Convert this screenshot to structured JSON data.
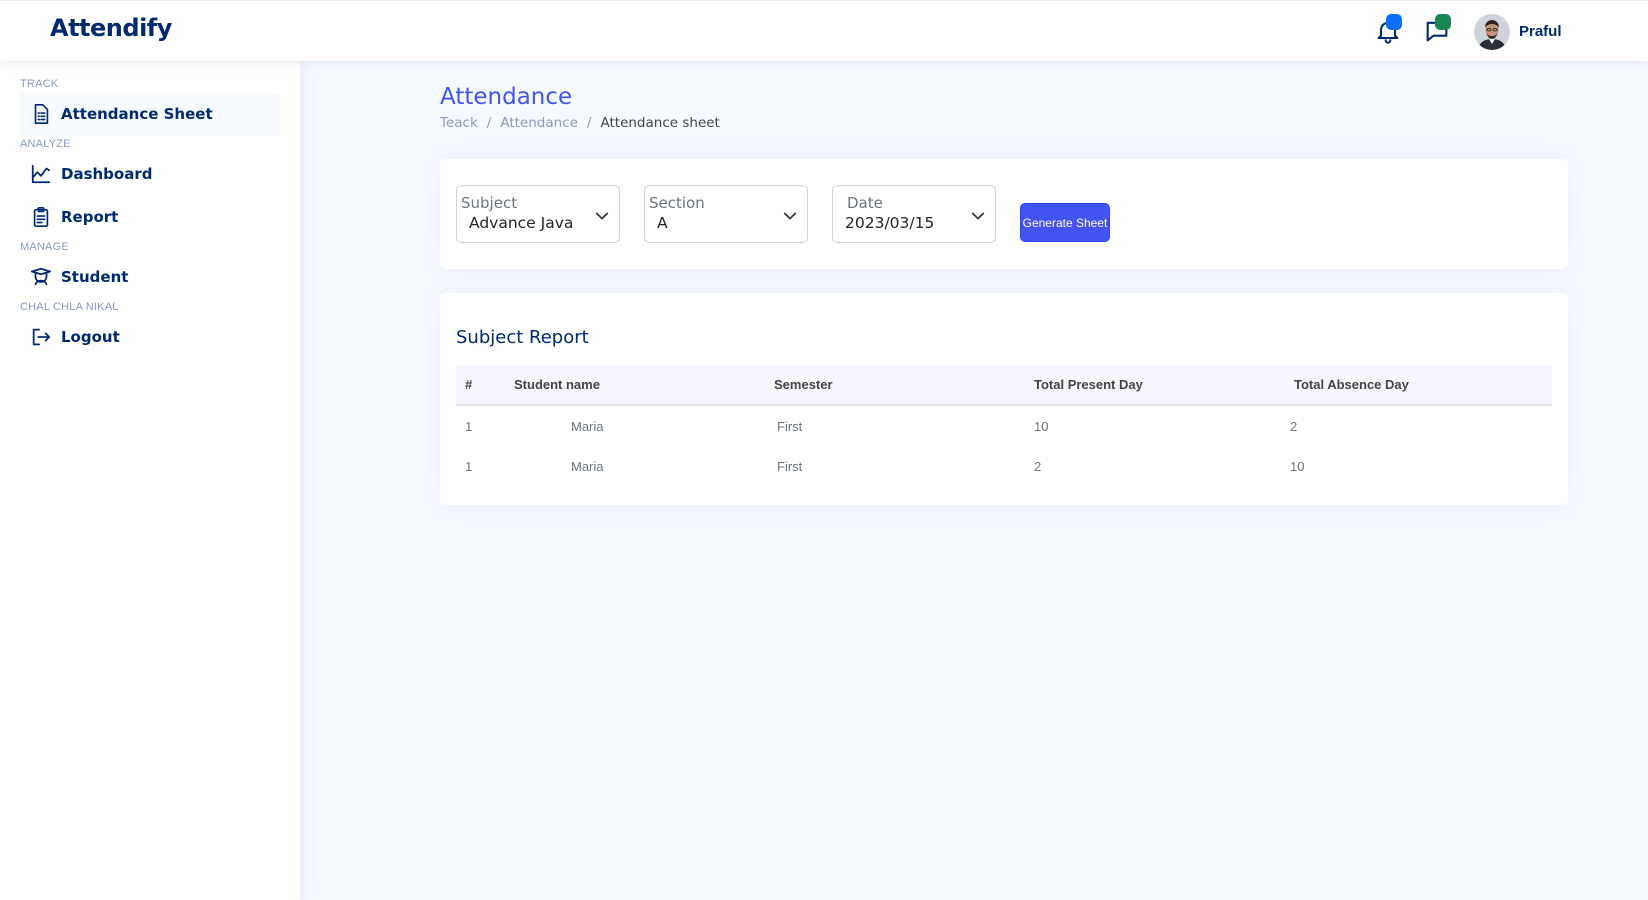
{
  "header": {
    "logo": "Attendify",
    "user_name": "Praful",
    "icons": [
      "bell-icon",
      "chat-icon"
    ],
    "badge_colors": [
      "#0d6efd",
      "#198754"
    ]
  },
  "sidebar": {
    "sections": [
      {
        "heading": "TRACK",
        "items": [
          {
            "label": "Attendance Sheet",
            "icon": "document-icon",
            "active": true
          }
        ]
      },
      {
        "heading": "ANALYZE",
        "items": [
          {
            "label": "Dashboard",
            "icon": "chart-icon"
          },
          {
            "label": "Report",
            "icon": "clipboard-icon"
          }
        ]
      },
      {
        "heading": "MANAGE",
        "items": [
          {
            "label": "Student",
            "icon": "student-icon"
          }
        ]
      },
      {
        "heading": "CHAL CHLA NIKAL",
        "items": [
          {
            "label": "Logout",
            "icon": "logout-icon"
          }
        ]
      }
    ]
  },
  "page": {
    "title": "Attendance",
    "breadcrumb": [
      "Teack",
      "Attendance",
      "Attendance sheet"
    ]
  },
  "filters": {
    "subject": {
      "label": "Subject",
      "value": "Advance Java"
    },
    "section": {
      "label": "Section",
      "value": "A"
    },
    "date": {
      "label": "Date",
      "value": "2023/03/15"
    },
    "generate_label": "Generate Sheet"
  },
  "report": {
    "title": "Subject Report",
    "columns": [
      "#",
      "Student name",
      "Semester",
      "Total Present Day",
      "Total Absence Day"
    ],
    "rows": [
      [
        "1",
        "Maria",
        "First",
        "10",
        "2"
      ],
      [
        "1",
        "Maria",
        "First",
        "2",
        "10"
      ]
    ]
  },
  "colors": {
    "accent": "#4154f1",
    "navy": "#012970",
    "muted": "#899bbd",
    "background": "#f6f9ff"
  }
}
